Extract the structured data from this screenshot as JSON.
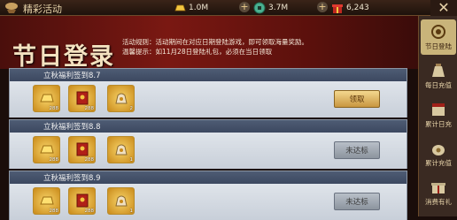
{
  "topbar": {
    "title": "精彩活动",
    "gold": "1.0M",
    "silver": "3.7M",
    "gift": "6,243",
    "close": "✕"
  },
  "banner": {
    "title": "节日登录",
    "rule_line1": "活动规则：活动期间在对应日期登陆游戏，即可领取海量奖励。",
    "rule_line2": "温馨提示：如11月28日登陆礼包，必须在当日领取"
  },
  "rows": [
    {
      "title": "立秋福利签到8.7",
      "items": [
        "288",
        "288",
        "2"
      ],
      "button": "领取",
      "state": "claim"
    },
    {
      "title": "立秋福利签到8.8",
      "items": [
        "288",
        "288",
        "1"
      ],
      "button": "未达标",
      "state": "na"
    },
    {
      "title": "立秋福利签到8.9",
      "items": [
        "288",
        "288",
        "1"
      ],
      "button": "未达标",
      "state": "na"
    }
  ],
  "sidebar": [
    {
      "label": "节日登陆",
      "icon": "laurel-icon"
    },
    {
      "label": "每日充值",
      "icon": "money-bag-icon"
    },
    {
      "label": "累计日充",
      "icon": "calendar-icon"
    },
    {
      "label": "累计充值",
      "icon": "coin-bag-icon"
    },
    {
      "label": "消费有礼",
      "icon": "gift-icon"
    }
  ]
}
